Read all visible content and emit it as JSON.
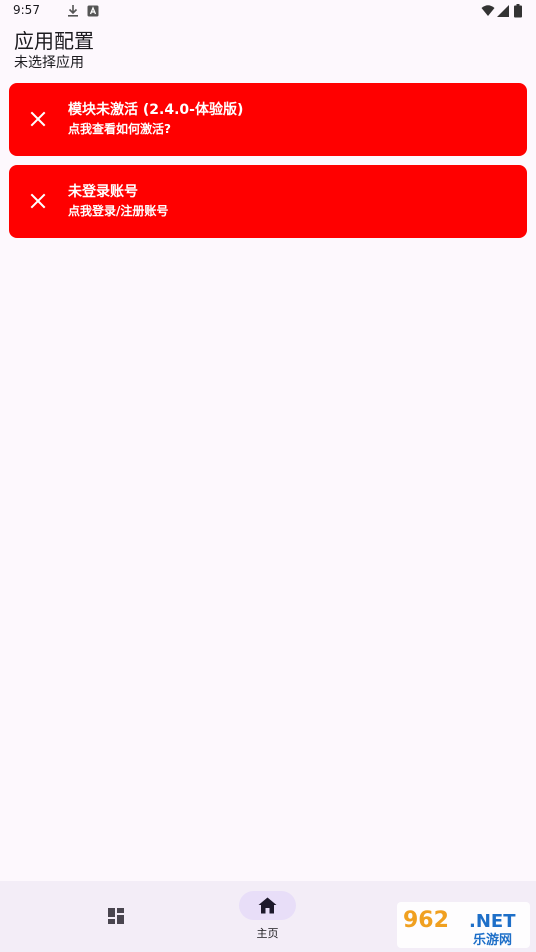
{
  "status_bar": {
    "time": "9:57",
    "icons": [
      "download-icon",
      "app-badge-icon",
      "wifi-icon",
      "signal-icon",
      "battery-icon"
    ]
  },
  "header": {
    "title": "应用配置",
    "subtitle": "未选择应用"
  },
  "cards": [
    {
      "icon": "close-icon",
      "title": "模块未激活 (2.4.0-体验版)",
      "subtitle": "点我查看如何激活?"
    },
    {
      "icon": "close-icon",
      "title": "未登录账号",
      "subtitle": "点我登录/注册账号"
    }
  ],
  "bottom_nav": {
    "items": [
      {
        "icon": "dashboard-icon",
        "label": ""
      },
      {
        "icon": "home-icon",
        "label": "主页",
        "selected": true
      }
    ]
  },
  "watermark": {
    "text_top": "962.NET",
    "text_bottom": "乐游网"
  },
  "colors": {
    "background": "#fdf8fd",
    "card_error": "#ff0000",
    "nav_background": "#f3edf7",
    "nav_indicator": "#e8def8"
  }
}
